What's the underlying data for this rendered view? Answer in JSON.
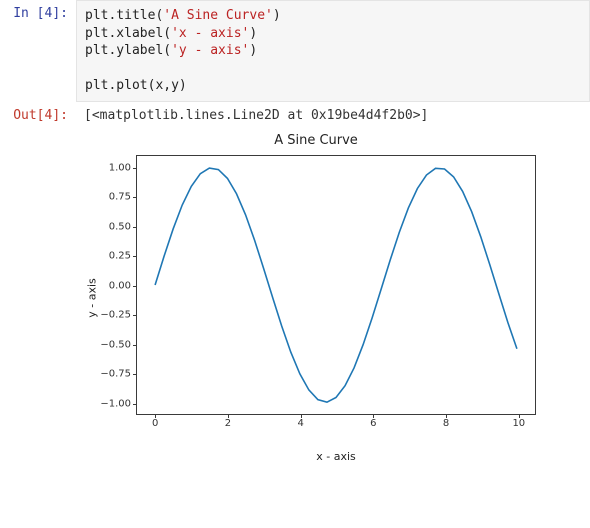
{
  "cell": {
    "in_prompt_prefix": "In [",
    "in_prompt_n": "4",
    "in_prompt_suffix": "]:",
    "out_prompt_prefix": "Out[",
    "out_prompt_n": "4",
    "out_prompt_suffix": "]:",
    "code": {
      "l1_a": "plt.title(",
      "l1_str": "'A Sine Curve'",
      "l1_b": ")",
      "l2_a": "plt.xlabel(",
      "l2_str": "'x - axis'",
      "l2_b": ")",
      "l3_a": "plt.ylabel(",
      "l3_str": "'y - axis'",
      "l3_b": ")",
      "l5": "plt.plot(x,y)"
    },
    "output_text": "[<matplotlib.lines.Line2D at 0x19be4d4f2b0>]"
  },
  "chart_data": {
    "type": "line",
    "title": "A Sine Curve",
    "xlabel": "x - axis",
    "ylabel": "y - axis",
    "xlim": [
      -0.5,
      10.5
    ],
    "ylim": [
      -1.1,
      1.1
    ],
    "xticks": [
      0,
      2,
      4,
      6,
      8,
      10
    ],
    "yticks": [
      -1.0,
      -0.75,
      -0.5,
      -0.25,
      0.0,
      0.25,
      0.5,
      0.75,
      1.0
    ],
    "ytick_labels": [
      "−1.00",
      "−0.75",
      "−0.50",
      "−0.25",
      "0.00",
      "0.25",
      "0.50",
      "0.75",
      "1.00"
    ],
    "x": [
      0,
      0.25,
      0.5,
      0.75,
      1,
      1.25,
      1.5,
      1.75,
      2,
      2.25,
      2.5,
      2.75,
      3,
      3.25,
      3.5,
      3.75,
      4,
      4.25,
      4.5,
      4.75,
      5,
      5.25,
      5.5,
      5.75,
      6,
      6.25,
      6.5,
      6.75,
      7,
      7.25,
      7.5,
      7.75,
      8,
      8.25,
      8.5,
      8.75,
      9,
      9.25,
      9.5,
      9.75,
      10
    ],
    "y": [
      0.0,
      0.247,
      0.479,
      0.682,
      0.841,
      0.949,
      0.997,
      0.984,
      0.909,
      0.778,
      0.599,
      0.382,
      0.141,
      -0.108,
      -0.351,
      -0.572,
      -0.757,
      -0.895,
      -0.978,
      -0.999,
      -0.959,
      -0.859,
      -0.706,
      -0.508,
      -0.279,
      -0.033,
      0.215,
      0.45,
      0.657,
      0.823,
      0.938,
      0.995,
      0.989,
      0.922,
      0.798,
      0.625,
      0.412,
      0.174,
      -0.075,
      -0.32,
      -0.544
    ]
  }
}
